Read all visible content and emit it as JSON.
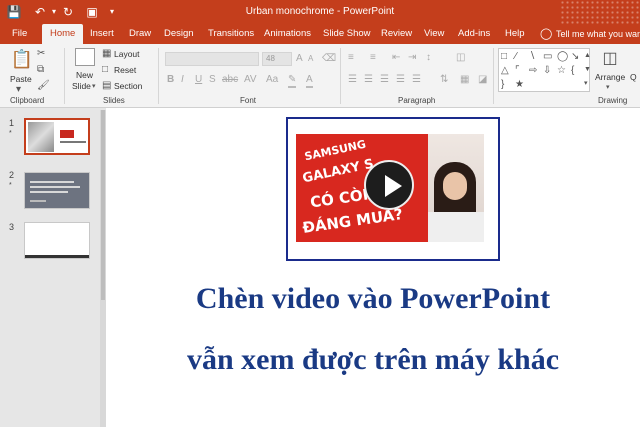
{
  "window": {
    "title": "Urban monochrome  -  PowerPoint"
  },
  "tabs": [
    {
      "label": "File"
    },
    {
      "label": "Home"
    },
    {
      "label": "Insert"
    },
    {
      "label": "Draw"
    },
    {
      "label": "Design"
    },
    {
      "label": "Transitions"
    },
    {
      "label": "Animations"
    },
    {
      "label": "Slide Show"
    },
    {
      "label": "Review"
    },
    {
      "label": "View"
    },
    {
      "label": "Add-ins"
    },
    {
      "label": "Help"
    }
  ],
  "tell_me": "Tell me what you want",
  "ribbon": {
    "clipboard": {
      "paste": "Paste",
      "label": "Clipboard"
    },
    "slides": {
      "new_slide": "New",
      "new_slide_2": "Slide",
      "layout": "Layout",
      "reset": "Reset",
      "section": "Section",
      "label": "Slides"
    },
    "font": {
      "size": "48",
      "label": "Font",
      "bold": "B",
      "italic": "I",
      "underline": "U",
      "strike": "S",
      "abc": "abc",
      "av": "AV",
      "aa": "Aa",
      "a": "A"
    },
    "paragraph": {
      "label": "Paragraph"
    },
    "drawing": {
      "arrange": "Arrange",
      "label": "Drawing",
      "quick_styles": "Q"
    }
  },
  "slides": [
    {
      "number": "1",
      "star": "*"
    },
    {
      "number": "2",
      "star": "*"
    },
    {
      "number": "3"
    }
  ],
  "video": {
    "line1": "SAMSUNG",
    "line2": "GALAXY S",
    "line3": "CÓ CÒN",
    "line4": "ĐÁNG MUA?"
  },
  "caption": {
    "line1": "Chèn video vào PowerPoint",
    "line2": "vẫn xem được trên máy khác"
  },
  "colors": {
    "accent": "#c43e1c",
    "caption": "#1a3a84",
    "frame": "#1a2b8c"
  }
}
